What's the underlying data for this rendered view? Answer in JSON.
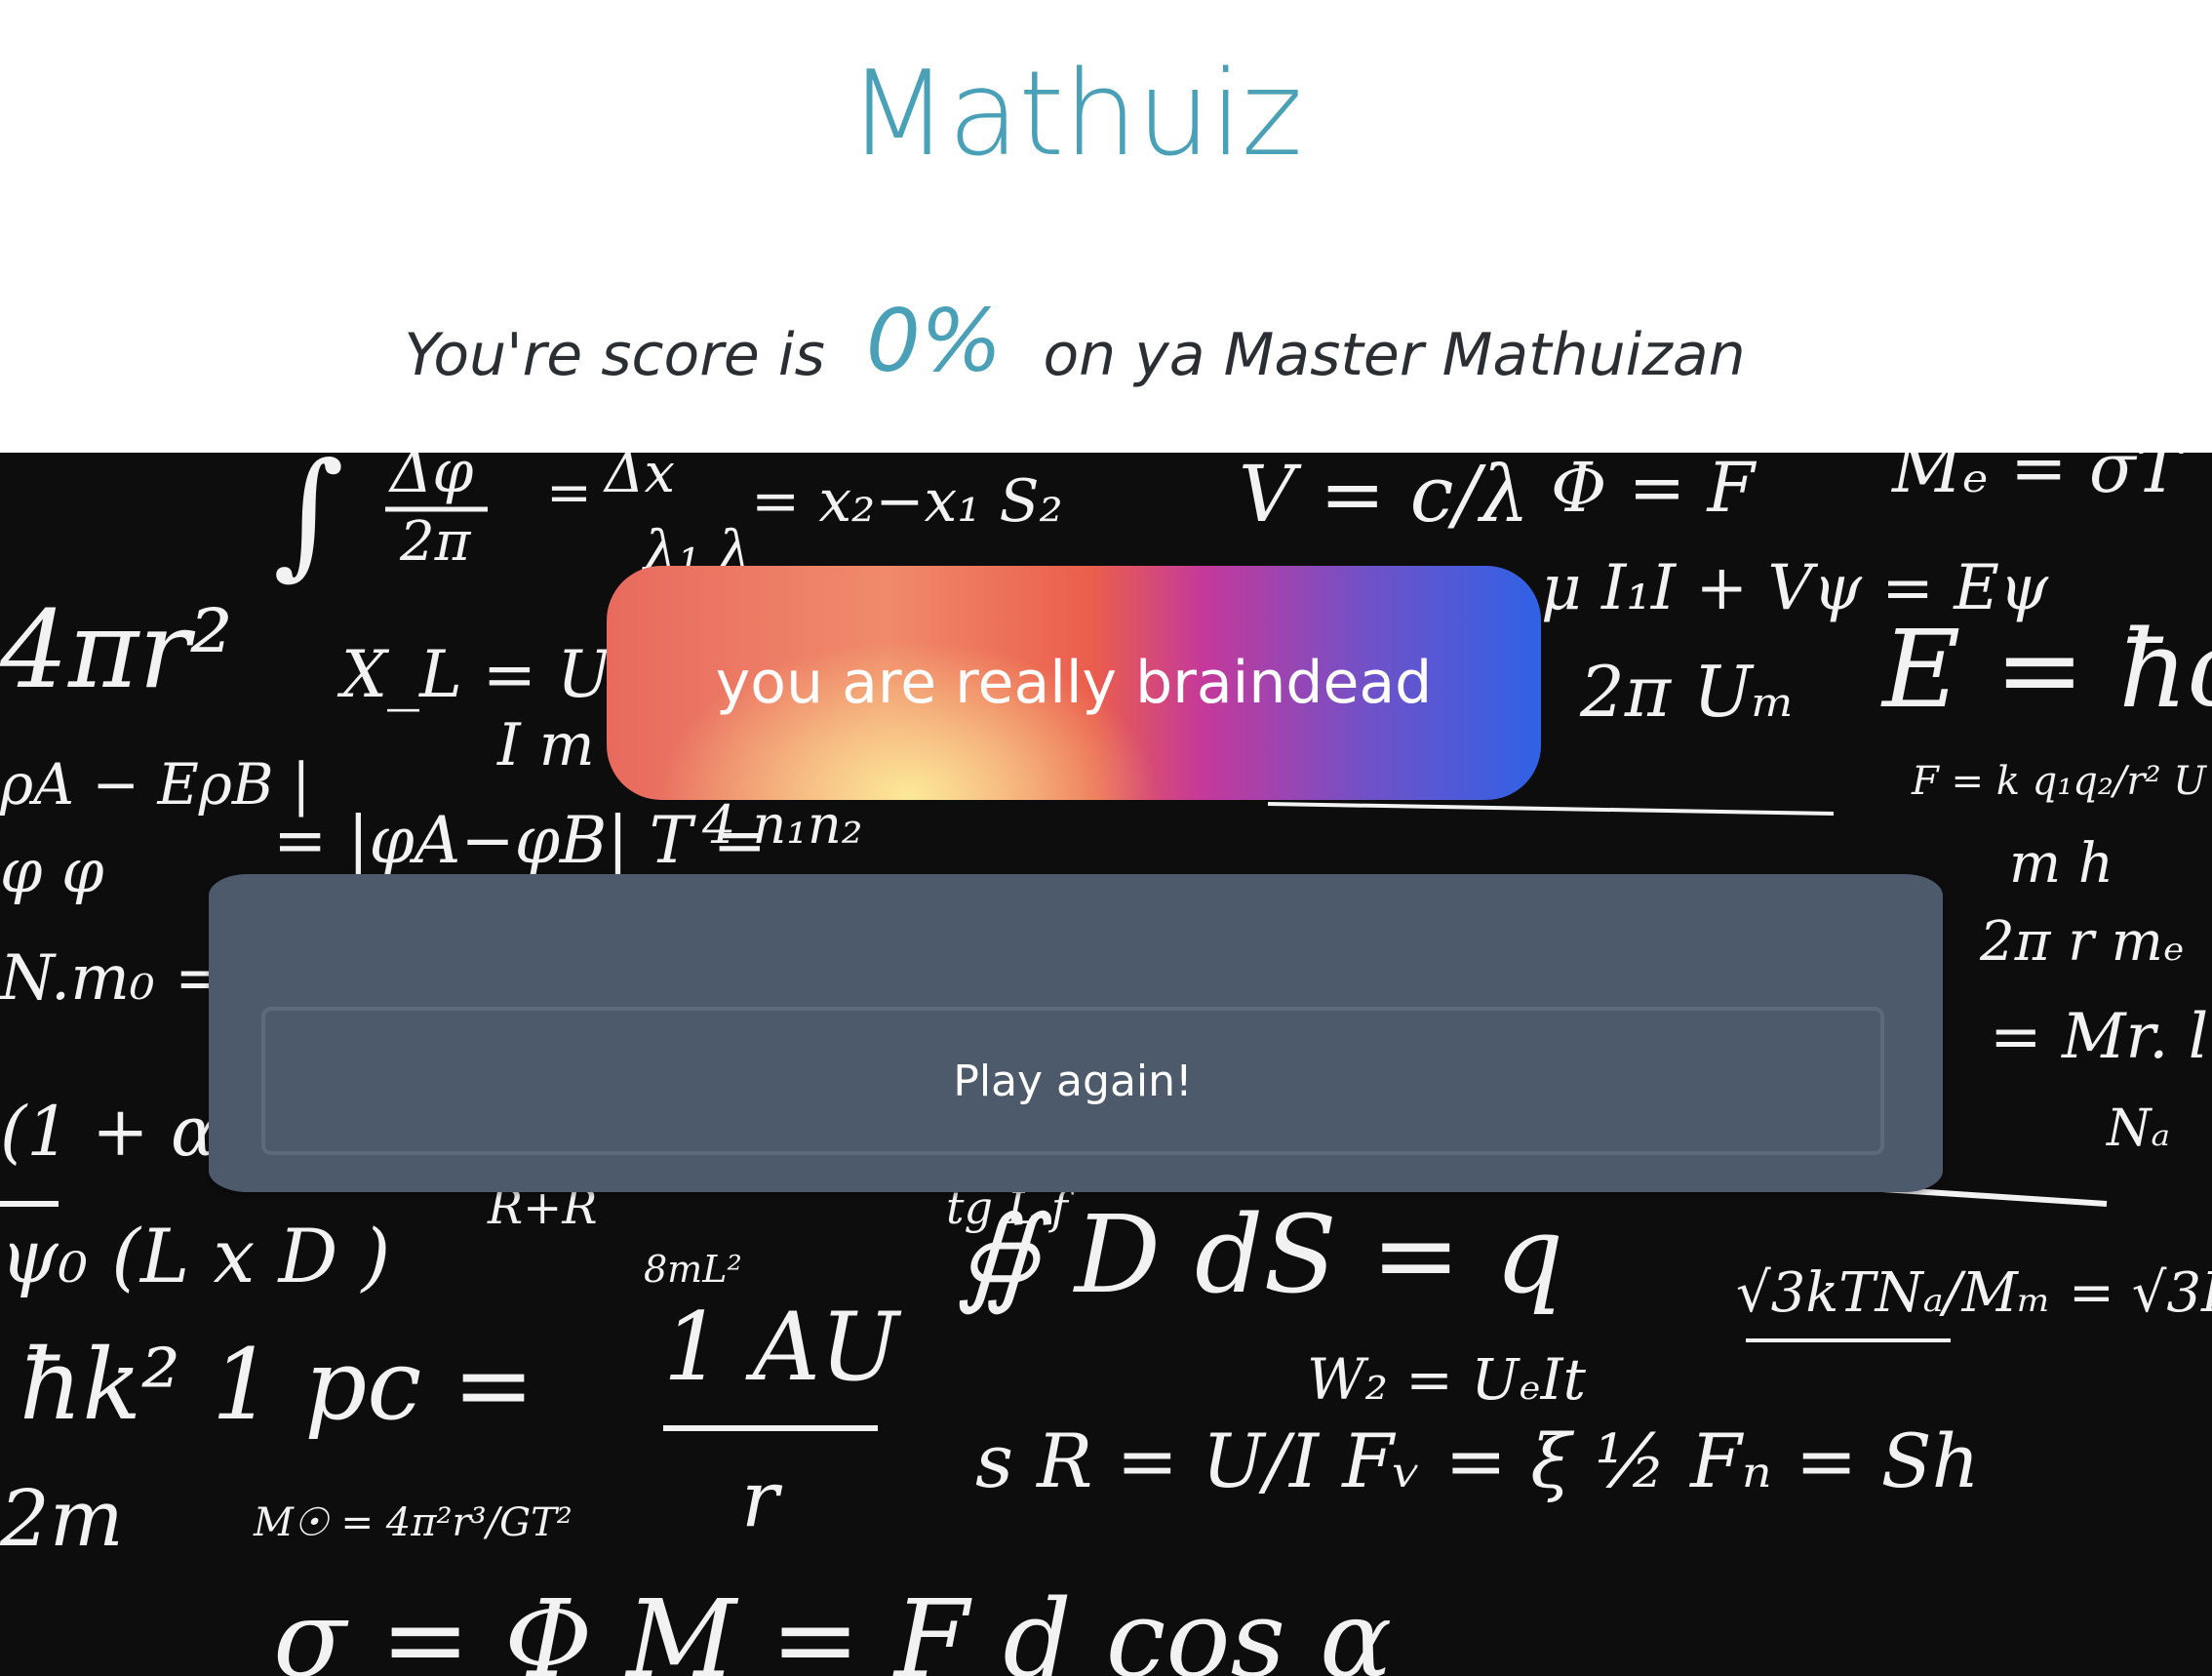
{
  "app": {
    "title": "Mathuiz"
  },
  "score": {
    "prefix": "You're score is",
    "percent": "0%",
    "suffix": "on ya Master Mathuizan"
  },
  "result": {
    "message": "you are really braindead"
  },
  "actions": {
    "play_again_label": "Play again!"
  },
  "colors": {
    "accent": "#4aa0b6",
    "panel": "#4d5a6b",
    "board": "#0d0d0d"
  }
}
